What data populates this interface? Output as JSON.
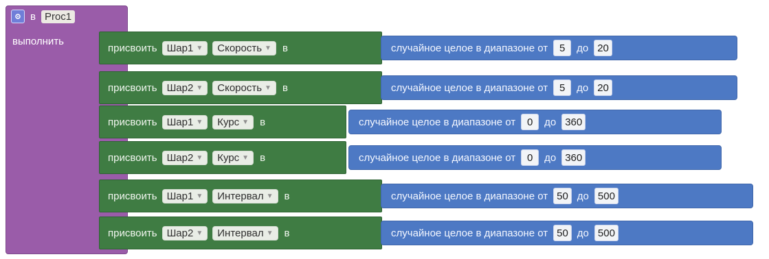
{
  "procedure": {
    "prefix": "в",
    "name": "Proc1",
    "do_label": "выполнить"
  },
  "rows": [
    {
      "verb": "присвоить",
      "object": "Шар1",
      "property": "Скорость",
      "into": "в",
      "random_label": "случайное целое в диапазоне от",
      "from": "5",
      "to_label": "до",
      "to": "20"
    },
    {
      "verb": "присвоить",
      "object": "Шар2",
      "property": "Скорость",
      "into": "в",
      "random_label": "случайное целое в диапазоне от",
      "from": "5",
      "to_label": "до",
      "to": "20"
    },
    {
      "verb": "присвоить",
      "object": "Шар1",
      "property": "Курс",
      "into": "в",
      "random_label": "случайное целое в диапазоне от",
      "from": "0",
      "to_label": "до",
      "to": "360"
    },
    {
      "verb": "присвоить",
      "object": "Шар2",
      "property": "Курс",
      "into": "в",
      "random_label": "случайное целое в диапазоне от",
      "from": "0",
      "to_label": "до",
      "to": "360"
    },
    {
      "verb": "присвоить",
      "object": "Шар1",
      "property": "Интервал",
      "into": "в",
      "random_label": "случайное целое в диапазоне от",
      "from": "50",
      "to_label": "до",
      "to": "500"
    },
    {
      "verb": "присвоить",
      "object": "Шар2",
      "property": "Интервал",
      "into": "в",
      "random_label": "случайное целое в диапазоне от",
      "from": "50",
      "to_label": "до",
      "to": "500"
    }
  ],
  "colors": {
    "procedure_block": "#9a5ca9",
    "setter_block": "#3f7c43",
    "math_block": "#4d79c4"
  }
}
